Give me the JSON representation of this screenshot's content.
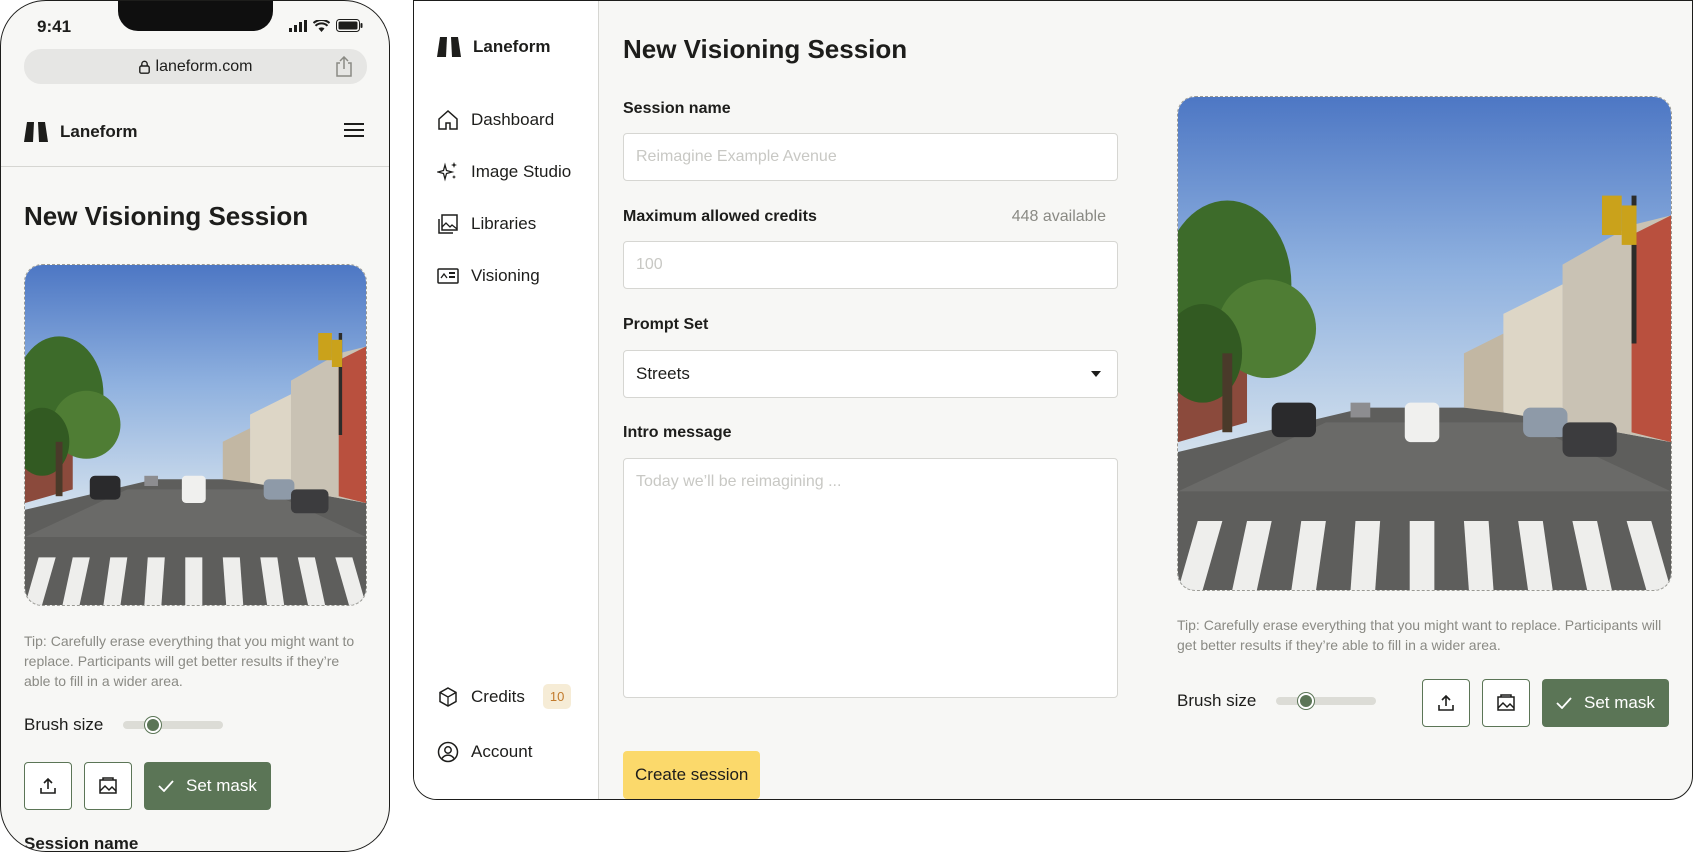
{
  "phone": {
    "status_time": "9:41",
    "url": "laneform.com",
    "brand": "Laneform",
    "title": "New Visioning Session",
    "tip": "Tip: Carefully erase everything that you might want to replace. Participants will get better results if they’re able to fill in a wider area.",
    "brush_label": "Brush size",
    "brush_level": 0.3,
    "set_mask_label": "Set mask",
    "next_field_label": "Session name"
  },
  "desktop": {
    "brand": "Laneform",
    "nav": [
      {
        "label": "Dashboard",
        "icon": "home-icon"
      },
      {
        "label": "Image Studio",
        "icon": "sparkles-icon"
      },
      {
        "label": "Libraries",
        "icon": "images-icon"
      },
      {
        "label": "Visioning",
        "icon": "visioning-icon"
      }
    ],
    "credits": {
      "label": "Credits",
      "badge": "10"
    },
    "account": {
      "label": "Account"
    },
    "title": "New Visioning Session",
    "form": {
      "session_name_label": "Session name",
      "session_name_placeholder": "Reimagine Example Avenue",
      "max_credits_label": "Maximum allowed credits",
      "available": "448 available",
      "max_credits_placeholder": "100",
      "prompt_set_label": "Prompt Set",
      "prompt_set_value": "Streets",
      "intro_label": "Intro message",
      "intro_placeholder": "Today we’ll be reimagining ...",
      "create_label": "Create session"
    },
    "tip": "Tip: Carefully erase everything that you might want to replace. Participants will get better results if they’re able to fill in a wider area.",
    "brush_label": "Brush size",
    "brush_level": 0.3,
    "set_mask_label": "Set mask"
  },
  "colors": {
    "accent_green": "#5b7556",
    "create_yellow": "#fbd96b",
    "badge_bg": "#f6ecd6",
    "badge_text": "#c27a2c"
  }
}
